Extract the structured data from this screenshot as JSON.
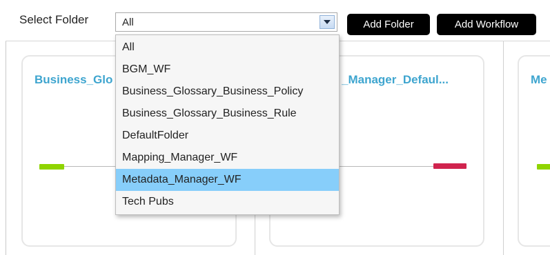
{
  "toolbar": {
    "select_label": "Select Folder",
    "select_value": "All",
    "add_folder_label": "Add Folder",
    "add_workflow_label": "Add Workflow"
  },
  "dropdown": {
    "options": [
      "All",
      "BGM_WF",
      "Business_Glossary_Business_Policy",
      "Business_Glossary_Business_Rule",
      "DefaultFolder",
      "Mapping_Manager_WF",
      "Metadata_Manager_WF",
      "Tech Pubs"
    ],
    "highlighted": "Metadata_Manager_WF"
  },
  "cards": [
    {
      "title": "Business_Glo",
      "node_color": "#8fd400"
    },
    {
      "title": "_Manager_Defaul...",
      "node_color": "#d0244e"
    },
    {
      "title": "Me",
      "node_color": "#8fd400"
    }
  ],
  "colors": {
    "accent_title": "#3ea5cf",
    "highlight": "#87cefa",
    "button_bg": "#000000"
  }
}
